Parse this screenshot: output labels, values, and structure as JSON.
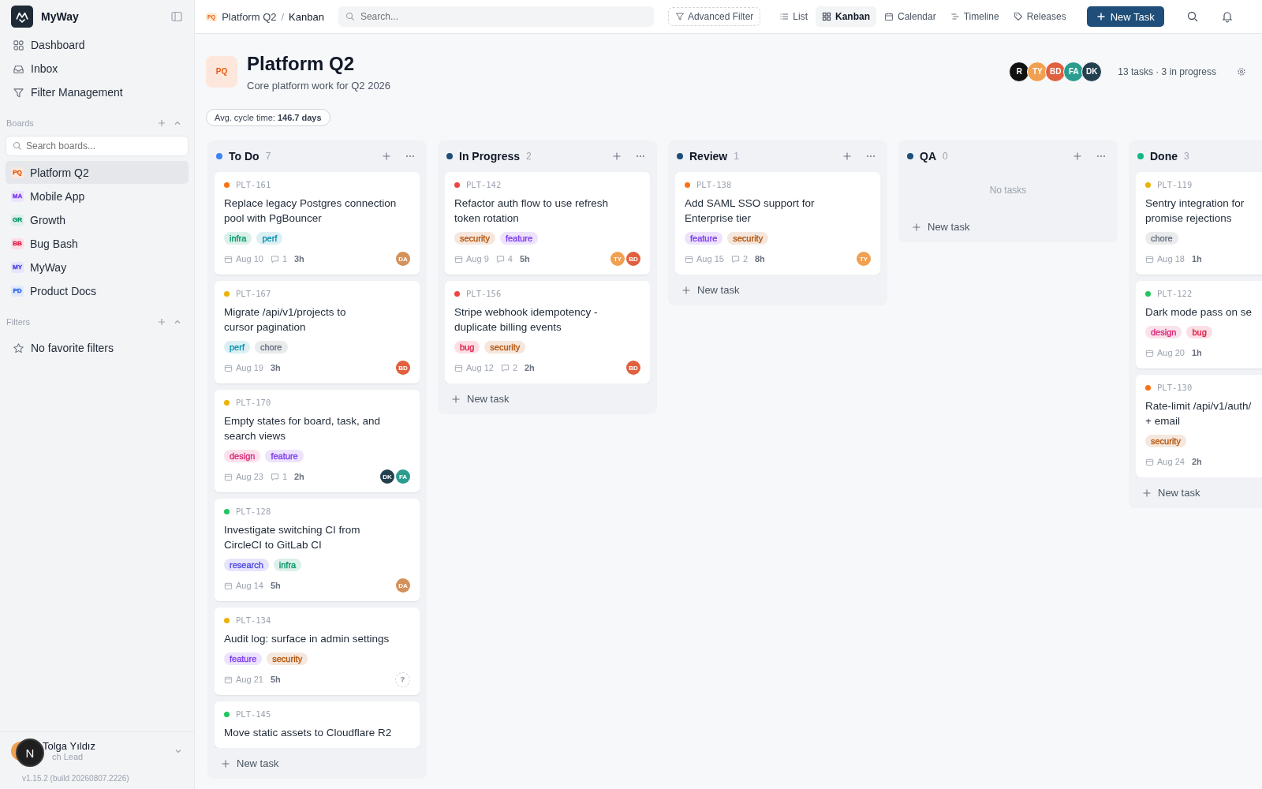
{
  "sidebar": {
    "app_name": "MyWay",
    "nav": [
      {
        "label": "Dashboard",
        "kind": "dashboard"
      },
      {
        "label": "Inbox",
        "kind": "inbox"
      },
      {
        "label": "Filter Management",
        "kind": "filter"
      }
    ],
    "boards_heading": "Boards",
    "boards_search": {
      "placeholder": "Search boards..."
    },
    "boards": [
      {
        "badge": "PQ",
        "label": "Platform Q2",
        "color": "#ea580c",
        "selected": true
      },
      {
        "badge": "MA",
        "label": "Mobile App",
        "color": "#7c3aed",
        "selected": false
      },
      {
        "badge": "GR",
        "label": "Growth",
        "color": "#059669",
        "selected": false
      },
      {
        "badge": "BB",
        "label": "Bug Bash",
        "color": "#e11d48",
        "selected": false
      },
      {
        "badge": "MY",
        "label": "MyWay",
        "color": "#4f46e5",
        "selected": false
      },
      {
        "badge": "PD",
        "label": "Product Docs",
        "color": "#2563eb",
        "selected": false
      }
    ],
    "filters_heading": "Filters",
    "filters_empty": "No favorite filters",
    "user": {
      "name": "Tolga Yıldız",
      "role": "ch Lead"
    },
    "version": "v1.15.2 (build 20260807.2226)",
    "dev_badge": "N"
  },
  "topbar": {
    "breadcrumb": [
      {
        "label": "Platform Q2",
        "badge": "PQ"
      },
      {
        "label": "Kanban"
      }
    ],
    "separator": "/",
    "search": {
      "placeholder": "Search..."
    },
    "advanced_filter": "Advanced Filter",
    "views": [
      {
        "label": "List",
        "kind": "list",
        "selected": false
      },
      {
        "label": "Kanban",
        "kind": "kanban",
        "selected": true
      },
      {
        "label": "Calendar",
        "kind": "calendar",
        "selected": false
      },
      {
        "label": "Timeline",
        "kind": "timeline",
        "selected": false
      },
      {
        "label": "Releases",
        "kind": "releases",
        "selected": false
      }
    ],
    "new_task": "New Task"
  },
  "header": {
    "badge": "PQ",
    "title": "Platform Q2",
    "subtitle": "Core platform work for Q2 2026",
    "members": [
      {
        "initials": "R",
        "color": "#111111"
      },
      {
        "initials": "TY",
        "color": "#f0a050"
      },
      {
        "initials": "BD",
        "color": "#e0603f"
      },
      {
        "initials": "FA",
        "color": "#2a9d8f"
      },
      {
        "initials": "DK",
        "color": "#23404f"
      }
    ],
    "summary": "13 tasks · 3 in progress",
    "cycle_label": "Avg. cycle time:",
    "cycle_value": "146.7 days"
  },
  "columns": [
    {
      "name": "To Do",
      "count": "7",
      "color": "#3b82f6",
      "actions": true,
      "add_label": "New task",
      "cards": [
        {
          "id": "PLT-161",
          "color": "#f97316",
          "title": "Replace legacy Postgres connection\npool with PgBouncer",
          "tags": [
            {
              "label": "infra",
              "color": "#059669"
            },
            {
              "label": "perf",
              "color": "#0891b2"
            }
          ],
          "date": "Aug 10",
          "comments": "1",
          "estimate": "3h",
          "assignees": [
            {
              "initials": "DA",
              "color": "#d4915a",
              "kind": "person"
            }
          ]
        },
        {
          "id": "PLT-167",
          "color": "#eab308",
          "title": "Migrate /api/v1/projects to\ncursor pagination",
          "tags": [
            {
              "label": "perf",
              "color": "#0891b2"
            },
            {
              "label": "chore",
              "color": "#6b7280"
            }
          ],
          "date": "Aug 19",
          "estimate": "3h",
          "assignees": [
            {
              "initials": "BD",
              "color": "#e0603f",
              "kind": "person"
            }
          ]
        },
        {
          "id": "PLT-170",
          "color": "#eab308",
          "title": "Empty states for board, task, and\nsearch views",
          "tags": [
            {
              "label": "design",
              "color": "#db2777"
            },
            {
              "label": "feature",
              "color": "#7c3aed"
            }
          ],
          "date": "Aug 23",
          "comments": "1",
          "estimate": "2h",
          "assignees": [
            {
              "initials": "DK",
              "color": "#23404f",
              "kind": "person"
            },
            {
              "initials": "FA",
              "color": "#2a9d8f",
              "kind": "person"
            }
          ]
        },
        {
          "id": "PLT-128",
          "color": "#22c55e",
          "title": "Investigate switching CI from\nCircleCI to GitLab CI",
          "tags": [
            {
              "label": "research",
              "color": "#4f46e5"
            },
            {
              "label": "infra",
              "color": "#059669"
            }
          ],
          "date": "Aug 14",
          "estimate": "5h",
          "assignees": [
            {
              "initials": "DA",
              "color": "#d4915a",
              "kind": "person"
            }
          ]
        },
        {
          "id": "PLT-134",
          "color": "#eab308",
          "title": "Audit log: surface in admin settings",
          "tags": [
            {
              "label": "feature",
              "color": "#7c3aed"
            },
            {
              "label": "security",
              "color": "#b45309"
            }
          ],
          "date": "Aug 21",
          "estimate": "5h",
          "assignees": [
            {
              "initials": "?",
              "color": "#9ca3af",
              "kind": "unassigned"
            }
          ]
        },
        {
          "id": "PLT-145",
          "color": "#22c55e",
          "title": "Move static assets to Cloudflare R2"
        }
      ]
    },
    {
      "name": "In Progress",
      "count": "2",
      "color": "#1e4e79",
      "actions": true,
      "add_label": "New task",
      "cards": [
        {
          "id": "PLT-142",
          "color": "#ef4444",
          "title": "Refactor auth flow to use refresh\ntoken rotation",
          "tags": [
            {
              "label": "security",
              "color": "#b45309"
            },
            {
              "label": "feature",
              "color": "#7c3aed"
            }
          ],
          "date": "Aug 9",
          "comments": "4",
          "estimate": "5h",
          "assignees": [
            {
              "initials": "TY",
              "color": "#f0a050",
              "kind": "person"
            },
            {
              "initials": "BD",
              "color": "#e0603f",
              "kind": "person"
            }
          ]
        },
        {
          "id": "PLT-156",
          "color": "#ef4444",
          "title": "Stripe webhook idempotency -\nduplicate billing events",
          "tags": [
            {
              "label": "bug",
              "color": "#e11d48"
            },
            {
              "label": "security",
              "color": "#b45309"
            }
          ],
          "date": "Aug 12",
          "comments": "2",
          "estimate": "2h",
          "assignees": [
            {
              "initials": "BD",
              "color": "#e0603f",
              "kind": "person"
            }
          ]
        }
      ]
    },
    {
      "name": "Review",
      "count": "1",
      "color": "#1e4e79",
      "actions": true,
      "add_label": "New task",
      "cards": [
        {
          "id": "PLT-138",
          "color": "#f97316",
          "title": "Add SAML SSO support for\nEnterprise tier",
          "tags": [
            {
              "label": "feature",
              "color": "#7c3aed"
            },
            {
              "label": "security",
              "color": "#b45309"
            }
          ],
          "date": "Aug 15",
          "comments": "2",
          "estimate": "8h",
          "assignees": [
            {
              "initials": "TY",
              "color": "#f0a050",
              "kind": "person"
            }
          ]
        }
      ]
    },
    {
      "name": "QA",
      "count": "0",
      "color": "#1e4e79",
      "actions": true,
      "add_label": "New task",
      "empty_text": "No tasks"
    },
    {
      "name": "Done",
      "count": "3",
      "color": "#10b981",
      "add_label": "New task",
      "cards": [
        {
          "id": "PLT-119",
          "color": "#eab308",
          "title": "Sentry integration for\npromise rejections",
          "tags": [
            {
              "label": "chore",
              "color": "#6b7280"
            }
          ],
          "date": "Aug 18",
          "estimate": "1h"
        },
        {
          "id": "PLT-122",
          "color": "#22c55e",
          "title": "Dark mode pass on se",
          "tags": [
            {
              "label": "design",
              "color": "#db2777"
            },
            {
              "label": "bug",
              "color": "#e11d48"
            }
          ],
          "date": "Aug 20",
          "estimate": "1h"
        },
        {
          "id": "PLT-130",
          "color": "#f97316",
          "title": "Rate-limit /api/v1/auth/\n+ email",
          "tags": [
            {
              "label": "security",
              "color": "#b45309"
            }
          ],
          "date": "Aug 24",
          "estimate": "2h"
        }
      ]
    }
  ]
}
